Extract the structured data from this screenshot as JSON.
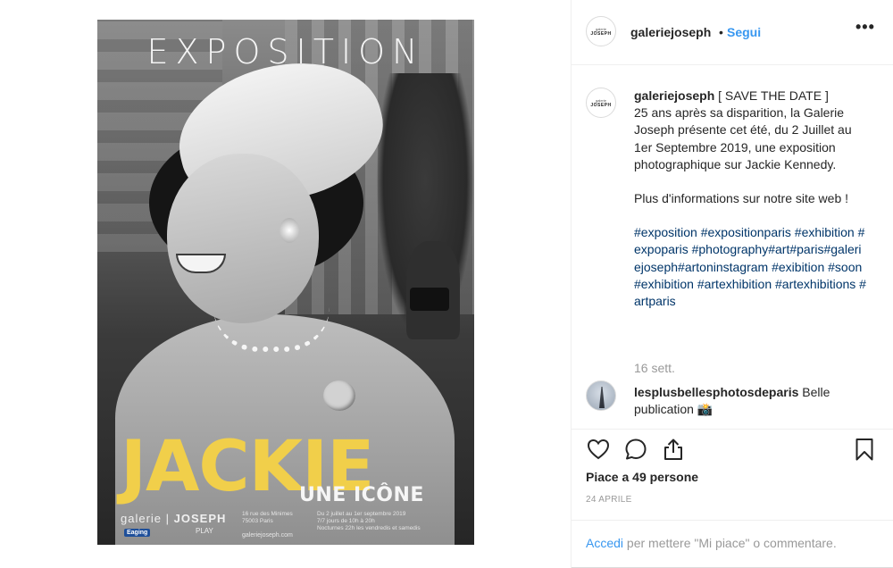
{
  "post": {
    "poster": {
      "title": "EXPOSITION",
      "headline": "JACKIE",
      "subheadline": "UNE ICÔNE",
      "gallery_prefix": "galerie",
      "gallery_sep": "|",
      "gallery_name": "JOSEPH",
      "address_line1": "16 rue des Minimes",
      "address_line2": "75003 Paris",
      "dates_line1": "Du 2 juillet au 1er septembre 2019",
      "dates_line2": "7/7 jours de 10h à 20h",
      "dates_line3": "Nocturnes 22h les vendredis et samedis",
      "website": "galeriejoseph.com",
      "sponsor1": "Eaging",
      "sponsor2": "PLAY"
    }
  },
  "header": {
    "avatar_top": "galerie",
    "avatar_bottom": "JOSEPH",
    "username": "galeriejoseph",
    "separator": "•",
    "follow_label": "Segui",
    "more_label": "•••"
  },
  "caption": {
    "username": "galeriejoseph",
    "line1": "[ SAVE THE DATE ]",
    "body": "25 ans après sa disparition, la Galerie Joseph présente cet été, du 2 Juillet au 1er Septembre 2019, une exposition photographique sur Jackie Kennedy.",
    "more_info": "Plus d'informations sur notre site web !",
    "hashtags": "#exposition #expositionparis #exhibition #expoparis #photography#art#paris#galeriejoseph#artoninstagram #exibition #soon #exhibition #artexhibition #artexhibitions #artparis",
    "time": "16 sett."
  },
  "comment": {
    "username": "lesplusbellesphotosdeparis",
    "text": "Belle publication 📸"
  },
  "actions": {
    "like_icon": "heart-icon",
    "comment_icon": "comment-icon",
    "share_icon": "share-icon",
    "save_icon": "bookmark-icon",
    "likes_text": "Piace a 49 persone",
    "date": "24 APRILE"
  },
  "login": {
    "link": "Accedi",
    "rest": " per mettere \"Mi piace\" o commentare."
  }
}
